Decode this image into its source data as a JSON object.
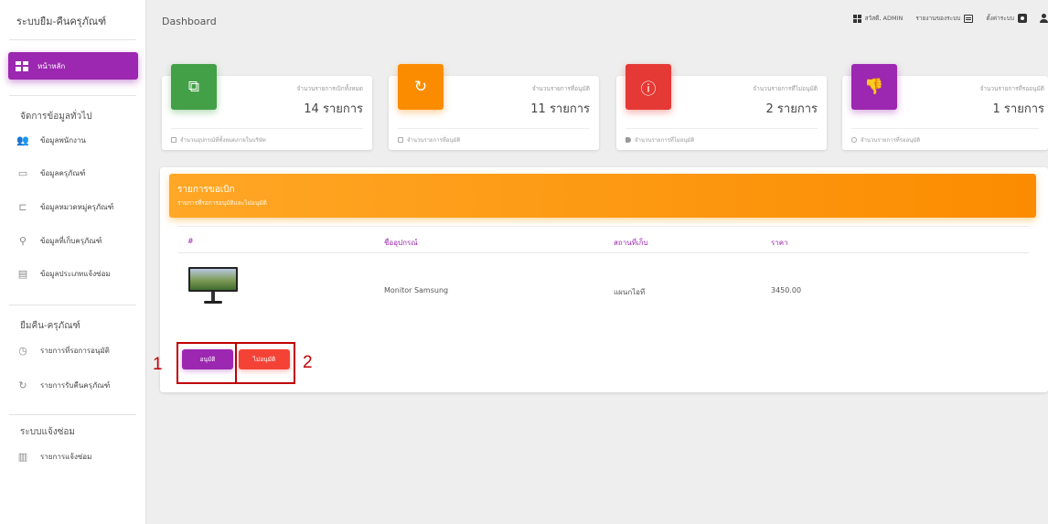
{
  "sidebar": {
    "brand": "ระบบยืม-คืนครุภัณฑ์",
    "home_label": "หน้าหลัก",
    "sections": [
      {
        "title": "จัดการข้อมูลทั่วไป",
        "items": [
          {
            "label": "ข้อมูลพนักงาน",
            "icon": "people-icon"
          },
          {
            "label": "ข้อมูลครุภัณฑ์",
            "icon": "monitor-icon"
          },
          {
            "label": "ข้อมูลหมวดหมู่ครุภัณฑ์",
            "icon": "laptop-icon"
          },
          {
            "label": "ข้อมูลที่เก็บครุภัณฑ์",
            "icon": "location-pin-icon"
          },
          {
            "label": "ข้อมูลประเภทแจ้งซ่อม",
            "icon": "clipboard-icon"
          }
        ]
      },
      {
        "title": "ยืมคืน-ครุภัณฑ์",
        "items": [
          {
            "label": "รายการที่รอการอนุมัติ",
            "icon": "clock-icon"
          },
          {
            "label": "รายการรับคืนครุภัณฑ์",
            "icon": "refresh-icon"
          }
        ]
      },
      {
        "title": "ระบบแจ้งซ่อม",
        "items": [
          {
            "label": "รายการแจ้งซ่อม",
            "icon": "document-icon"
          }
        ]
      }
    ]
  },
  "topbar": {
    "title": "Dashboard",
    "greeting": "สวัสดี, ADMIN",
    "report_label": "รายงานของระบบ",
    "settings_label": "ตั้งค่าระบบ"
  },
  "cards": [
    {
      "label": "จำนวนรายการเบิกทั้งหมด",
      "value": "14 รายการ",
      "footer": "จำนวนอุปกรณ์ที่ทั้งหมดภายในบริษัท",
      "color": "#43a047",
      "icon": "copy-icon"
    },
    {
      "label": "จำนวนรายการที่อนุมัติ",
      "value": "11 รายการ",
      "footer": "จำนวนรายการที่อนุมัติ",
      "color": "#fb8c00",
      "icon": "refresh-icon"
    },
    {
      "label": "จำนวนรายการที่ไม่อนุมัติ",
      "value": "2 รายการ",
      "footer": "จำนวนรายการที่ไม่อนุมัติ",
      "color": "#e53935",
      "icon": "info-icon"
    },
    {
      "label": "จำนวนรายการที่รออนุมัติ",
      "value": "1 รายการ",
      "footer": "จำนวนรายการที่รออนุมัติ",
      "color": "#9c27b0",
      "icon": "thumbs-down-icon"
    }
  ],
  "panel": {
    "title": "รายการขอเบิก",
    "subtitle": "รายการที่รอการอนุมัติและไม่อนุมัติ",
    "columns": [
      "#",
      "ชื่ออุปกรณ์",
      "สถานที่เก็บ",
      "ราคา"
    ],
    "rows": [
      {
        "name": "Monitor Samsung",
        "location": "แผนกไอที",
        "price": "3450.00"
      }
    ],
    "approve_label": "อนุมัติ",
    "reject_label": "ไม่อนุมัติ"
  },
  "annotations": [
    "1",
    "2"
  ]
}
